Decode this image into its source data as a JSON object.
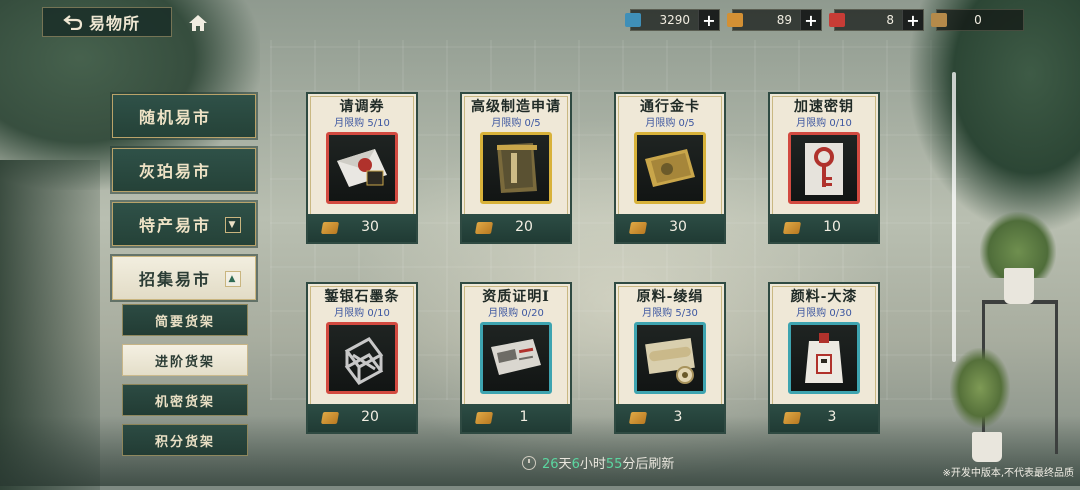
{
  "header": {
    "title": "易物所"
  },
  "currencies": [
    {
      "icon": "blue-ticket-icon",
      "value": "3290",
      "color": "#3f8fb8"
    },
    {
      "icon": "orange-book-icon",
      "value": "89",
      "color": "#d39034"
    },
    {
      "icon": "red-envelope-icon",
      "value": "8",
      "color": "#c73c36"
    },
    {
      "icon": "token-card-icon",
      "value": "0",
      "color": "#b58a4a"
    }
  ],
  "plus_label": "+",
  "nav": {
    "main": [
      {
        "label": "随机易市"
      },
      {
        "label": "灰珀易市"
      },
      {
        "label": "特产易市",
        "toggle": "▼"
      },
      {
        "label": "招集易市",
        "toggle": "▲"
      }
    ],
    "sub": [
      {
        "label": "简要货架"
      },
      {
        "label": "进阶货架"
      },
      {
        "label": "机密货架"
      },
      {
        "label": "积分货架"
      }
    ]
  },
  "items": [
    {
      "name": "请调券",
      "limit": "月限购 5/10",
      "price": "30",
      "frame": "red",
      "icon": "letter-icon"
    },
    {
      "name": "高级制造申请",
      "limit": "月限购 0/5",
      "price": "20",
      "frame": "gold",
      "icon": "application-book-icon"
    },
    {
      "name": "通行金卡",
      "limit": "月限购 0/5",
      "price": "30",
      "frame": "gold",
      "icon": "gold-card-icon"
    },
    {
      "name": "加速密钥",
      "limit": "月限购 0/10",
      "price": "10",
      "frame": "red",
      "icon": "key-icon"
    },
    {
      "name": "錾银石墨条",
      "limit": "月限购 0/10",
      "price": "20",
      "frame": "red",
      "icon": "graphite-frame-icon"
    },
    {
      "name": "资质证明Ⅰ",
      "limit": "月限购 0/20",
      "price": "1",
      "frame": "teal",
      "icon": "certificate-icon"
    },
    {
      "name": "原料-绫绢",
      "limit": "月限购 5/30",
      "price": "3",
      "frame": "teal",
      "icon": "silk-roll-icon"
    },
    {
      "name": "颜料-大漆",
      "limit": "月限购 0/30",
      "price": "3",
      "frame": "teal",
      "icon": "lacquer-bag-icon"
    }
  ],
  "refresh": {
    "days": "26",
    "days_unit": "天",
    "hours": "6",
    "hours_unit": "小时",
    "minutes": "55",
    "minutes_unit": "分后刷新"
  },
  "disclaimer": "※开发中版本,不代表最终品质"
}
